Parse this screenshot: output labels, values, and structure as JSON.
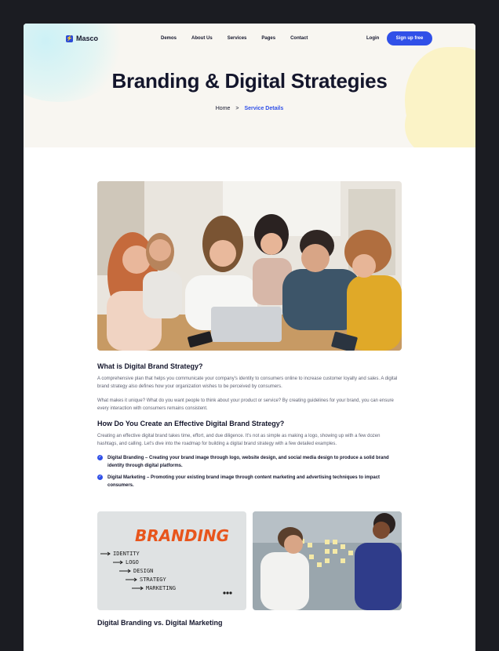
{
  "nav": {
    "logo_text": "Masco",
    "items": [
      "Demos",
      "About Us",
      "Services",
      "Pages",
      "Contact"
    ],
    "login": "Login",
    "signup": "Sign up free"
  },
  "hero": {
    "title": "Branding & Digital Strategies",
    "breadcrumb_home": "Home",
    "breadcrumb_sep": ">",
    "breadcrumb_current": "Service Details"
  },
  "article": {
    "h1": "What is Digital Brand Strategy?",
    "p1": "A comprehensive plan that helps you communicate your company's identity to consumers online to increase customer loyalty and sales. A digital brand strategy also defines how your organization wishes to be perceived by consumers.",
    "p2": "What makes it unique? What do you want people to think about your product or service? By creating guidelines for your brand, you can ensure every interaction with consumers remains consistent.",
    "h2": "How Do You Create an Effective Digital Brand Strategy?",
    "p3": "Creating an effective digital brand takes time, effort, and due diligence. It's not as simple as making a logo, showing up with a few dozen hashtags, and calling. Let's dive into the roadmap for building a digital brand strategy with a few detailed examples.",
    "bullets": [
      "Digital Branding – Creating your brand image through logo, website design, and social media design to produce a solid brand identity through digital platforms.",
      "Digital Marketing – Promoting your existing brand image through content marketing and advertising techniques to impact consumers."
    ],
    "branding_word": "BRANDING",
    "branding_list": [
      "IDENTITY",
      "LOGO",
      "DESIGN",
      "STRATEGY",
      "MARKETING"
    ],
    "h3": "Digital Branding vs. Digital Marketing"
  },
  "colors": {
    "accent": "#3050e8",
    "heading": "#14162c",
    "orange": "#e8551c"
  }
}
